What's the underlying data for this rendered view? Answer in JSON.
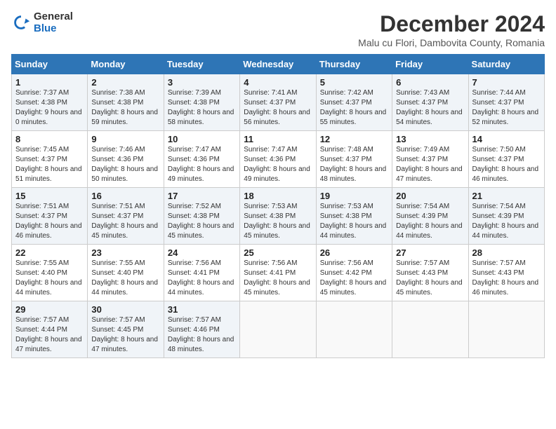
{
  "logo": {
    "general": "General",
    "blue": "Blue"
  },
  "title": "December 2024",
  "subtitle": "Malu cu Flori, Dambovita County, Romania",
  "days_of_week": [
    "Sunday",
    "Monday",
    "Tuesday",
    "Wednesday",
    "Thursday",
    "Friday",
    "Saturday"
  ],
  "weeks": [
    [
      {
        "day": "1",
        "sunrise": "7:37 AM",
        "sunset": "4:38 PM",
        "daylight": "9 hours and 0 minutes"
      },
      {
        "day": "2",
        "sunrise": "7:38 AM",
        "sunset": "4:38 PM",
        "daylight": "8 hours and 59 minutes"
      },
      {
        "day": "3",
        "sunrise": "7:39 AM",
        "sunset": "4:38 PM",
        "daylight": "8 hours and 58 minutes"
      },
      {
        "day": "4",
        "sunrise": "7:41 AM",
        "sunset": "4:37 PM",
        "daylight": "8 hours and 56 minutes"
      },
      {
        "day": "5",
        "sunrise": "7:42 AM",
        "sunset": "4:37 PM",
        "daylight": "8 hours and 55 minutes"
      },
      {
        "day": "6",
        "sunrise": "7:43 AM",
        "sunset": "4:37 PM",
        "daylight": "8 hours and 54 minutes"
      },
      {
        "day": "7",
        "sunrise": "7:44 AM",
        "sunset": "4:37 PM",
        "daylight": "8 hours and 52 minutes"
      }
    ],
    [
      {
        "day": "8",
        "sunrise": "7:45 AM",
        "sunset": "4:37 PM",
        "daylight": "8 hours and 51 minutes"
      },
      {
        "day": "9",
        "sunrise": "7:46 AM",
        "sunset": "4:36 PM",
        "daylight": "8 hours and 50 minutes"
      },
      {
        "day": "10",
        "sunrise": "7:47 AM",
        "sunset": "4:36 PM",
        "daylight": "8 hours and 49 minutes"
      },
      {
        "day": "11",
        "sunrise": "7:47 AM",
        "sunset": "4:36 PM",
        "daylight": "8 hours and 49 minutes"
      },
      {
        "day": "12",
        "sunrise": "7:48 AM",
        "sunset": "4:37 PM",
        "daylight": "8 hours and 48 minutes"
      },
      {
        "day": "13",
        "sunrise": "7:49 AM",
        "sunset": "4:37 PM",
        "daylight": "8 hours and 47 minutes"
      },
      {
        "day": "14",
        "sunrise": "7:50 AM",
        "sunset": "4:37 PM",
        "daylight": "8 hours and 46 minutes"
      }
    ],
    [
      {
        "day": "15",
        "sunrise": "7:51 AM",
        "sunset": "4:37 PM",
        "daylight": "8 hours and 46 minutes"
      },
      {
        "day": "16",
        "sunrise": "7:51 AM",
        "sunset": "4:37 PM",
        "daylight": "8 hours and 45 minutes"
      },
      {
        "day": "17",
        "sunrise": "7:52 AM",
        "sunset": "4:38 PM",
        "daylight": "8 hours and 45 minutes"
      },
      {
        "day": "18",
        "sunrise": "7:53 AM",
        "sunset": "4:38 PM",
        "daylight": "8 hours and 45 minutes"
      },
      {
        "day": "19",
        "sunrise": "7:53 AM",
        "sunset": "4:38 PM",
        "daylight": "8 hours and 44 minutes"
      },
      {
        "day": "20",
        "sunrise": "7:54 AM",
        "sunset": "4:39 PM",
        "daylight": "8 hours and 44 minutes"
      },
      {
        "day": "21",
        "sunrise": "7:54 AM",
        "sunset": "4:39 PM",
        "daylight": "8 hours and 44 minutes"
      }
    ],
    [
      {
        "day": "22",
        "sunrise": "7:55 AM",
        "sunset": "4:40 PM",
        "daylight": "8 hours and 44 minutes"
      },
      {
        "day": "23",
        "sunrise": "7:55 AM",
        "sunset": "4:40 PM",
        "daylight": "8 hours and 44 minutes"
      },
      {
        "day": "24",
        "sunrise": "7:56 AM",
        "sunset": "4:41 PM",
        "daylight": "8 hours and 44 minutes"
      },
      {
        "day": "25",
        "sunrise": "7:56 AM",
        "sunset": "4:41 PM",
        "daylight": "8 hours and 45 minutes"
      },
      {
        "day": "26",
        "sunrise": "7:56 AM",
        "sunset": "4:42 PM",
        "daylight": "8 hours and 45 minutes"
      },
      {
        "day": "27",
        "sunrise": "7:57 AM",
        "sunset": "4:43 PM",
        "daylight": "8 hours and 45 minutes"
      },
      {
        "day": "28",
        "sunrise": "7:57 AM",
        "sunset": "4:43 PM",
        "daylight": "8 hours and 46 minutes"
      }
    ],
    [
      {
        "day": "29",
        "sunrise": "7:57 AM",
        "sunset": "4:44 PM",
        "daylight": "8 hours and 47 minutes"
      },
      {
        "day": "30",
        "sunrise": "7:57 AM",
        "sunset": "4:45 PM",
        "daylight": "8 hours and 47 minutes"
      },
      {
        "day": "31",
        "sunrise": "7:57 AM",
        "sunset": "4:46 PM",
        "daylight": "8 hours and 48 minutes"
      },
      null,
      null,
      null,
      null
    ]
  ]
}
